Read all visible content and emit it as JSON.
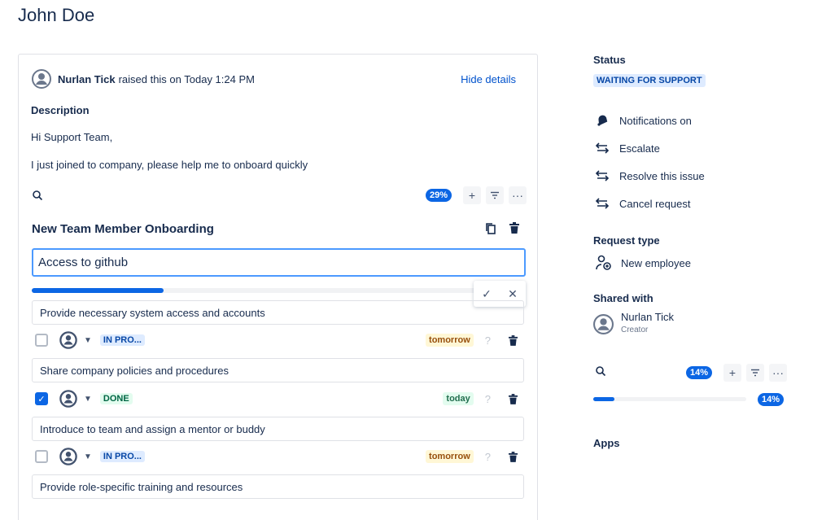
{
  "page": {
    "title": "John Doe"
  },
  "request": {
    "raiser_name": "Nurlan Tick",
    "raised_text": "raised this on Today 1:24 PM",
    "hide_details": "Hide details",
    "description_heading": "Description",
    "description_lines": [
      "Hi Support Team,",
      "I just joined to company, please help me to onboard quickly"
    ]
  },
  "checklist": {
    "progress_label": "29%",
    "progress": 0.29,
    "title": "New Team Member Onboarding",
    "edit_value": "Access to github",
    "items": [
      {
        "text": "Provide necessary system access and accounts",
        "checked": false,
        "status": "IN PRO...",
        "due": "tomorrow",
        "help": "?"
      },
      {
        "text": "Share company policies and procedures",
        "checked": true,
        "status": "DONE",
        "due": "today",
        "help": "?"
      },
      {
        "text": "Introduce to team and assign a mentor or buddy",
        "checked": false,
        "status": "IN PRO...",
        "due": "tomorrow",
        "help": "?"
      },
      {
        "text": "Provide role-specific training and resources"
      }
    ]
  },
  "sidebar": {
    "status_heading": "Status",
    "status_value": "WAITING FOR SUPPORT",
    "actions": [
      "Notifications on",
      "Escalate",
      "Resolve this issue",
      "Cancel request"
    ],
    "request_type_heading": "Request type",
    "request_type_value": "New employee",
    "shared_heading": "Shared with",
    "shared_name": "Nurlan Tick",
    "shared_role": "Creator",
    "progress_label": "14%",
    "progress": 0.14,
    "apps_heading": "Apps"
  },
  "colors": {
    "accent": "#0c66e4",
    "text": "#172b4d",
    "inprogress_bg": "#deebff",
    "done_bg": "#e3fcef",
    "tomorrow_bg": "#fff7d6"
  },
  "icons": [
    "user-avatar-icon",
    "search-icon",
    "plus-icon",
    "filter-icon",
    "more-icon",
    "copy-icon",
    "trash-icon",
    "check-icon",
    "close-icon",
    "chevron-down-icon",
    "bell-icon",
    "swap-icon",
    "new-employee-icon"
  ]
}
